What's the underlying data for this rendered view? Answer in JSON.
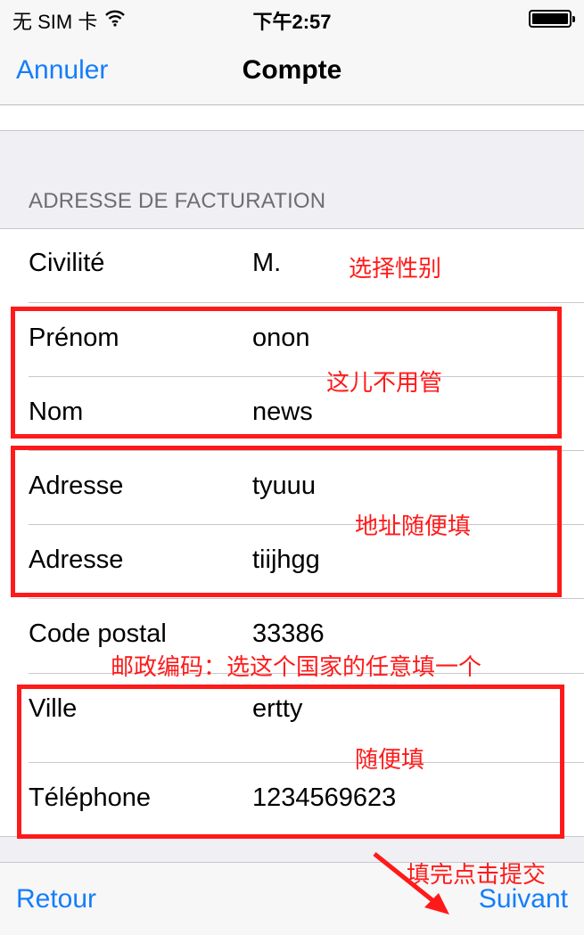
{
  "status_bar": {
    "carrier": "无 SIM 卡",
    "time": "下午2:57"
  },
  "nav": {
    "cancel_label": "Annuler",
    "title": "Compte"
  },
  "section_header": "ADRESSE DE FACTURATION",
  "fields": [
    {
      "label": "Civilité",
      "value": "M."
    },
    {
      "label": "Prénom",
      "value": "onon"
    },
    {
      "label": "Nom",
      "value": "news"
    },
    {
      "label": "Adresse",
      "value": "tyuuu"
    },
    {
      "label": "Adresse",
      "value": "tiijhgg"
    },
    {
      "label": "Code postal",
      "value": "33386"
    },
    {
      "label": "Ville",
      "value": "ertty"
    },
    {
      "label": "Téléphone",
      "value": "1234569623"
    }
  ],
  "toolbar": {
    "back_label": "Retour",
    "next_label": "Suivant"
  },
  "annotations": {
    "gender": "选择性别",
    "ignore": "这儿不用管",
    "address": "地址随便填",
    "postal": "邮政编码：选这个国家的任意填一个",
    "fill_any": "随便填",
    "submit": "填完点击提交"
  },
  "colors": {
    "ios_blue": "#147efb",
    "annotation_red": "#ff1a1a"
  }
}
